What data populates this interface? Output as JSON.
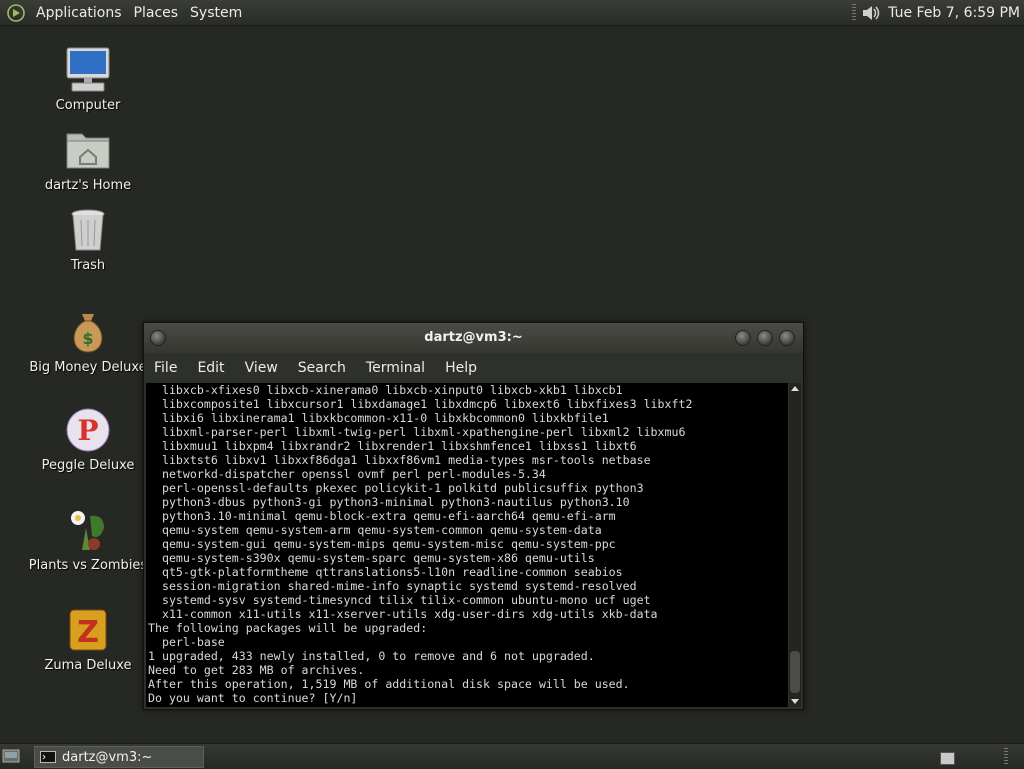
{
  "top_panel": {
    "menus": [
      "Applications",
      "Places",
      "System"
    ],
    "clock": "Tue Feb  7,  6:59 PM",
    "logo_icon": "gnome-foot-icon",
    "volume_icon": "speaker-icon"
  },
  "desktop": {
    "icons": [
      {
        "label": "Computer",
        "icon": "computer-icon"
      },
      {
        "label": "dartz's Home",
        "icon": "home-folder-icon"
      },
      {
        "label": "Trash",
        "icon": "trash-icon"
      },
      {
        "label": "Big Money Deluxe",
        "icon": "money-bag-icon"
      },
      {
        "label": "Peggle Deluxe",
        "icon": "peggle-icon"
      },
      {
        "label": "Plants vs Zombies",
        "icon": "plants-vs-zombies-icon"
      },
      {
        "label": "Zuma Deluxe",
        "icon": "zuma-icon"
      }
    ]
  },
  "terminal": {
    "title": "dartz@vm3:~",
    "menus": [
      "File",
      "Edit",
      "View",
      "Search",
      "Terminal",
      "Help"
    ],
    "lines": [
      "  libxcb-xfixes0 libxcb-xinerama0 libxcb-xinput0 libxcb-xkb1 libxcb1",
      "  libxcomposite1 libxcursor1 libxdamage1 libxdmcp6 libxext6 libxfixes3 libxft2",
      "  libxi6 libxinerama1 libxkbcommon-x11-0 libxkbcommon0 libxkbfile1",
      "  libxml-parser-perl libxml-twig-perl libxml-xpathengine-perl libxml2 libxmu6",
      "  libxmuu1 libxpm4 libxrandr2 libxrender1 libxshmfence1 libxss1 libxt6",
      "  libxtst6 libxv1 libxxf86dga1 libxxf86vm1 media-types msr-tools netbase",
      "  networkd-dispatcher openssl ovmf perl perl-modules-5.34",
      "  perl-openssl-defaults pkexec policykit-1 polkitd publicsuffix python3",
      "  python3-dbus python3-gi python3-minimal python3-nautilus python3.10",
      "  python3.10-minimal qemu-block-extra qemu-efi-aarch64 qemu-efi-arm",
      "  qemu-system qemu-system-arm qemu-system-common qemu-system-data",
      "  qemu-system-gui qemu-system-mips qemu-system-misc qemu-system-ppc",
      "  qemu-system-s390x qemu-system-sparc qemu-system-x86 qemu-utils",
      "  qt5-gtk-platformtheme qttranslations5-l10n readline-common seabios",
      "  session-migration shared-mime-info synaptic systemd systemd-resolved",
      "  systemd-sysv systemd-timesyncd tilix tilix-common ubuntu-mono ucf uget",
      "  x11-common x11-utils x11-xserver-utils xdg-user-dirs xdg-utils xkb-data",
      "The following packages will be upgraded:",
      "  perl-base",
      "1 upgraded, 433 newly installed, 0 to remove and 6 not upgraded.",
      "Need to get 283 MB of archives.",
      "After this operation, 1,519 MB of additional disk space will be used.",
      "Do you want to continue? [Y/n]"
    ]
  },
  "taskbar": {
    "tasks": [
      {
        "label": "dartz@vm3:~",
        "icon": "terminal-icon"
      }
    ]
  }
}
